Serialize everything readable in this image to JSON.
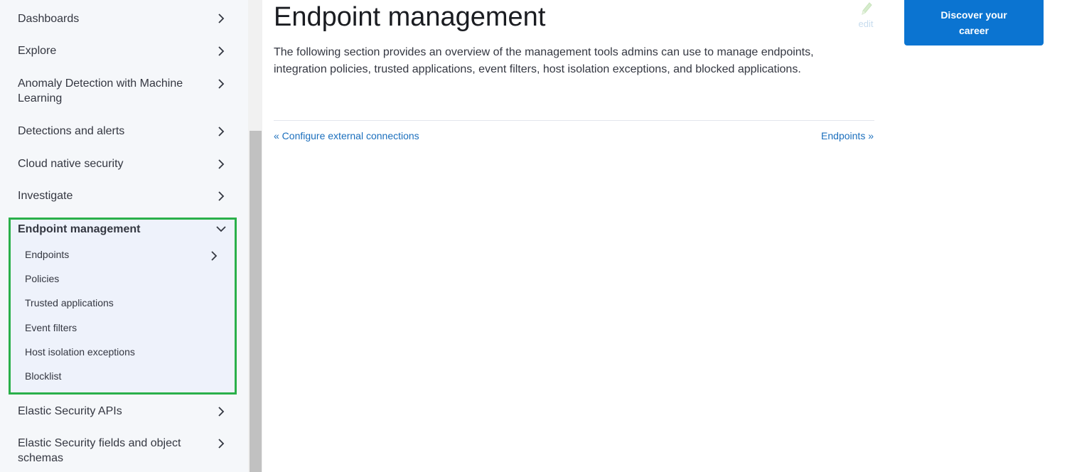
{
  "sidebar": {
    "items_top": [
      {
        "label": "Dashboards"
      },
      {
        "label": "Explore"
      },
      {
        "label": "Anomaly Detection with Machine Learning"
      },
      {
        "label": "Detections and alerts"
      },
      {
        "label": "Cloud native security"
      },
      {
        "label": "Investigate"
      }
    ],
    "active_group": {
      "label": "Endpoint management",
      "children": [
        {
          "label": "Endpoints"
        },
        {
          "label": "Policies"
        },
        {
          "label": "Trusted applications"
        },
        {
          "label": "Event filters"
        },
        {
          "label": "Host isolation exceptions"
        },
        {
          "label": "Blocklist"
        }
      ]
    },
    "items_bottom": [
      {
        "label": "Elastic Security APIs"
      },
      {
        "label": "Elastic Security fields and object schemas"
      }
    ]
  },
  "main": {
    "title": "Endpoint management",
    "edit_label": "edit",
    "intro": "The following section provides an overview of the management tools admins can use to manage endpoints, integration policies, trusted applications, event filters, host isolation exceptions, and blocked applications.",
    "prev_link": "« Configure external connections",
    "next_link": "Endpoints »"
  },
  "cta": {
    "label": "Discover your career"
  },
  "colors": {
    "link": "#1b6fbd",
    "cta_bg": "#0b74d1",
    "highlight_border": "#2ab04a"
  }
}
